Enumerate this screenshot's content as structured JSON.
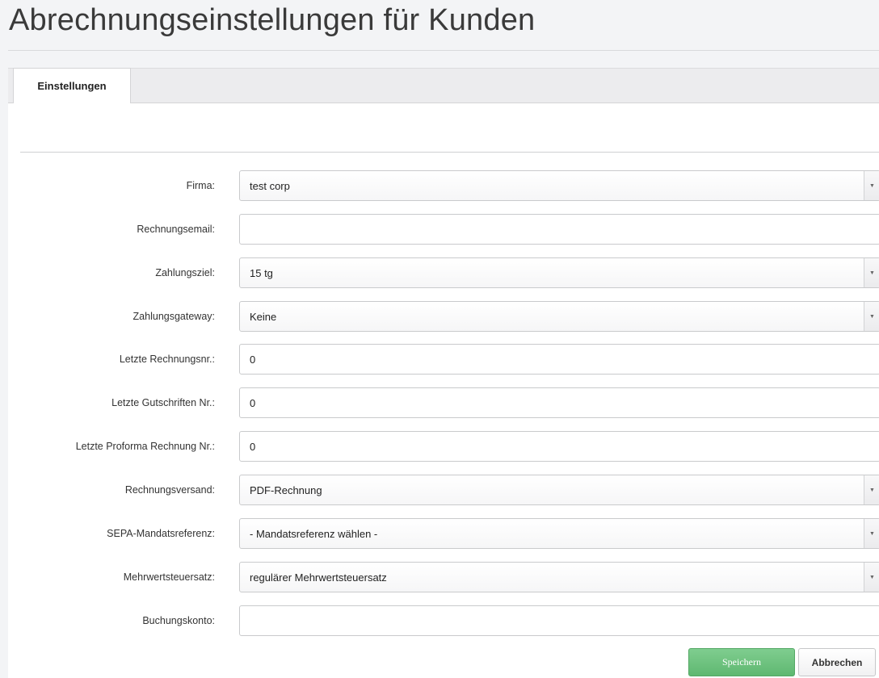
{
  "page": {
    "title": "Abrechnungseinstellungen für Kunden"
  },
  "tabs": [
    {
      "label": "Einstellungen",
      "active": true
    }
  ],
  "form": {
    "firma": {
      "label": "Firma:",
      "value": "test corp"
    },
    "rechnungsemail": {
      "label": "Rechnungsemail:",
      "value": ""
    },
    "zahlungsziel": {
      "label": "Zahlungsziel:",
      "value": "15 tg"
    },
    "zahlungsgateway": {
      "label": "Zahlungsgateway:",
      "value": "Keine"
    },
    "letzte_rechnungsnr": {
      "label": "Letzte Rechnungsnr.:",
      "value": "0"
    },
    "letzte_gutschriften_nr": {
      "label": "Letzte Gutschriften Nr.:",
      "value": "0"
    },
    "letzte_proforma_nr": {
      "label": "Letzte Proforma Rechnung Nr.:",
      "value": "0"
    },
    "rechnungsversand": {
      "label": "Rechnungsversand:",
      "value": "PDF-Rechnung"
    },
    "sepa_mandatsreferenz": {
      "label": "SEPA-Mandatsreferenz:",
      "value": "- Mandatsreferenz wählen -"
    },
    "mehrwertsteuersatz": {
      "label": "Mehrwertsteuersatz:",
      "value": "regulärer Mehrwertsteuersatz"
    },
    "buchungskonto": {
      "label": "Buchungskonto:",
      "value": ""
    }
  },
  "actions": {
    "save_label": "Speichern",
    "cancel_label": "Abbrechen"
  },
  "icons": {
    "select_arrow": "caret-down-icon"
  },
  "colors": {
    "save_button": "#6cc17c",
    "tab_active": "#ffffff",
    "page_background": "#f3f4f6"
  }
}
